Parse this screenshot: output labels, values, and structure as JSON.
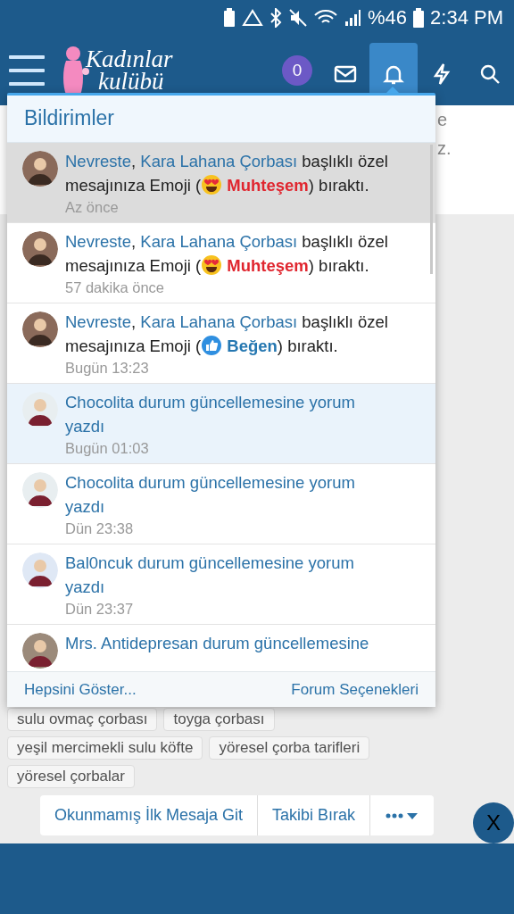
{
  "status_bar": {
    "battery_percent": "%46",
    "time": "2:34 PM"
  },
  "header": {
    "logo": [
      "Kadınlar",
      "kulübü"
    ],
    "badge": "0",
    "icons": [
      {
        "kind": "mail",
        "selected": false
      },
      {
        "kind": "bell",
        "selected": true
      },
      {
        "kind": "bolt",
        "selected": false
      },
      {
        "kind": "search",
        "selected": false
      }
    ]
  },
  "background_card": {
    "fragments": [
      "e",
      "z."
    ]
  },
  "notifications": {
    "title": "Bildirimler",
    "items": [
      {
        "kind": "reaction",
        "selected": true,
        "unread": false,
        "user": "Nevreste",
        "separator": ",",
        "thread": "Kara Lahana Çorbası",
        "text_before": "başlıklı özel mesajınıza Emoji (",
        "reaction": {
          "kind": "love",
          "label": "Muhteşem",
          "color": "#e0262f"
        },
        "text_after": ") bıraktı.",
        "time": "Az önce"
      },
      {
        "kind": "reaction",
        "selected": false,
        "unread": false,
        "user": "Nevreste",
        "separator": ",",
        "thread": "Kara Lahana Çorbası",
        "text_before": "başlıklı özel mesajınıza Emoji (",
        "reaction": {
          "kind": "love",
          "label": "Muhteşem",
          "color": "#e0262f"
        },
        "text_after": ") bıraktı.",
        "time": "57 dakika önce"
      },
      {
        "kind": "reaction",
        "selected": false,
        "unread": false,
        "user": "Nevreste",
        "separator": ",",
        "thread": "Kara Lahana Çorbası",
        "text_before": "başlıklı özel mesajınıza Emoji (",
        "reaction": {
          "kind": "like",
          "label": "Beğen",
          "color": "#2577b1"
        },
        "text_after": ") bıraktı.",
        "time": "Bugün 13:23"
      },
      {
        "kind": "comment",
        "selected": false,
        "unread": true,
        "text": "Chocolita durum güncellemesine yorum yazdı",
        "time": "Bugün 01:03"
      },
      {
        "kind": "comment",
        "selected": false,
        "unread": false,
        "text": "Chocolita durum güncellemesine yorum yazdı",
        "time": "Dün 23:38"
      },
      {
        "kind": "comment",
        "selected": false,
        "unread": false,
        "text": "Bal0ncuk durum güncellemesine yorum yazdı",
        "time": "Dün 23:37"
      },
      {
        "kind": "comment",
        "selected": false,
        "unread": false,
        "text": "Mrs. Antidepresan durum güncellemesine"
      }
    ],
    "footer": [
      "Hepsini Göster...",
      "Forum Seçenekleri"
    ]
  },
  "tags": [
    "sulu ovmaç çorbası",
    "toyga çorbası",
    "yeşil mercimekli sulu köfte",
    "yöresel çorba tarifleri",
    "yöresel çorbalar"
  ],
  "actions": [
    "Okunmamış İlk Mesaja Git",
    "Takibi Bırak"
  ],
  "close_button": "X"
}
